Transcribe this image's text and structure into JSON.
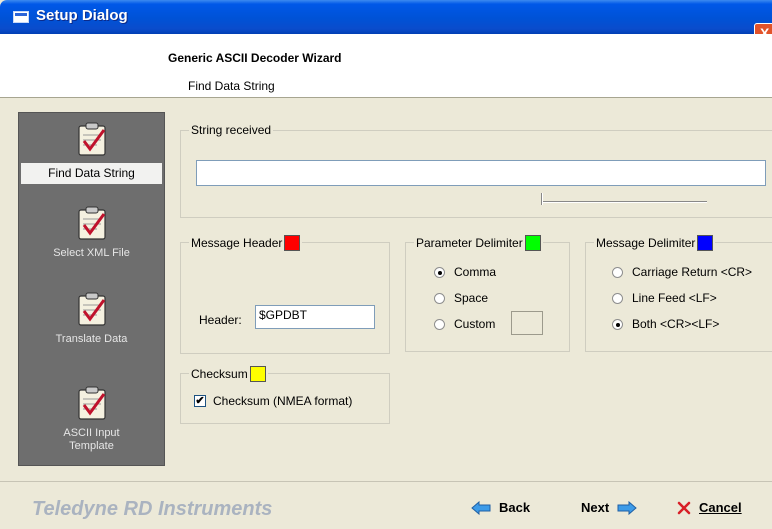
{
  "window": {
    "title": "Setup Dialog",
    "close_glyph": "X"
  },
  "header": {
    "title": "Generic ASCII Decoder Wizard",
    "subtitle": "Find Data String"
  },
  "sidebar": {
    "items": [
      {
        "label": "Find Data String",
        "icon": "clipboard-check-icon",
        "active": true
      },
      {
        "label": "Select XML File",
        "icon": "clipboard-check-icon",
        "active": false
      },
      {
        "label": "Translate Data",
        "icon": "clipboard-check-icon",
        "active": false
      },
      {
        "label": "ASCII Input Template",
        "label_line1": "ASCII Input",
        "label_line2": "Template",
        "icon": "clipboard-check-icon",
        "active": false
      }
    ]
  },
  "string_received": {
    "legend": "String received",
    "value": ""
  },
  "message_header": {
    "legend": "Message Header",
    "color": "#ff0000",
    "field_label": "Header:",
    "value": "$GPDBT"
  },
  "parameter_delimiter": {
    "legend": "Parameter Delimiter",
    "color": "#00ff00",
    "options": [
      {
        "label": "Comma",
        "selected": true
      },
      {
        "label": "Space",
        "selected": false
      },
      {
        "label": "Custom",
        "selected": false
      }
    ],
    "custom_value": ""
  },
  "message_delimiter": {
    "legend": "Message Delimiter",
    "color": "#0000ff",
    "options": [
      {
        "label": "Carriage Return <CR>",
        "selected": false
      },
      {
        "label": "Line Feed <LF>",
        "selected": false
      },
      {
        "label": "Both <CR><LF>",
        "selected": true
      }
    ]
  },
  "checksum": {
    "legend": "Checksum",
    "color": "#ffff00",
    "checkbox_label": "Checksum (NMEA format)",
    "checked": true,
    "check_glyph": "✔"
  },
  "footer": {
    "brand": "Teledyne RD Instruments",
    "back_label": "Back",
    "next_label": "Next",
    "cancel_label": "Cancel"
  },
  "colors": {
    "titlebar": "#0054e3",
    "sidebar": "#6e6e6e",
    "dialog": "#ece9d8"
  }
}
